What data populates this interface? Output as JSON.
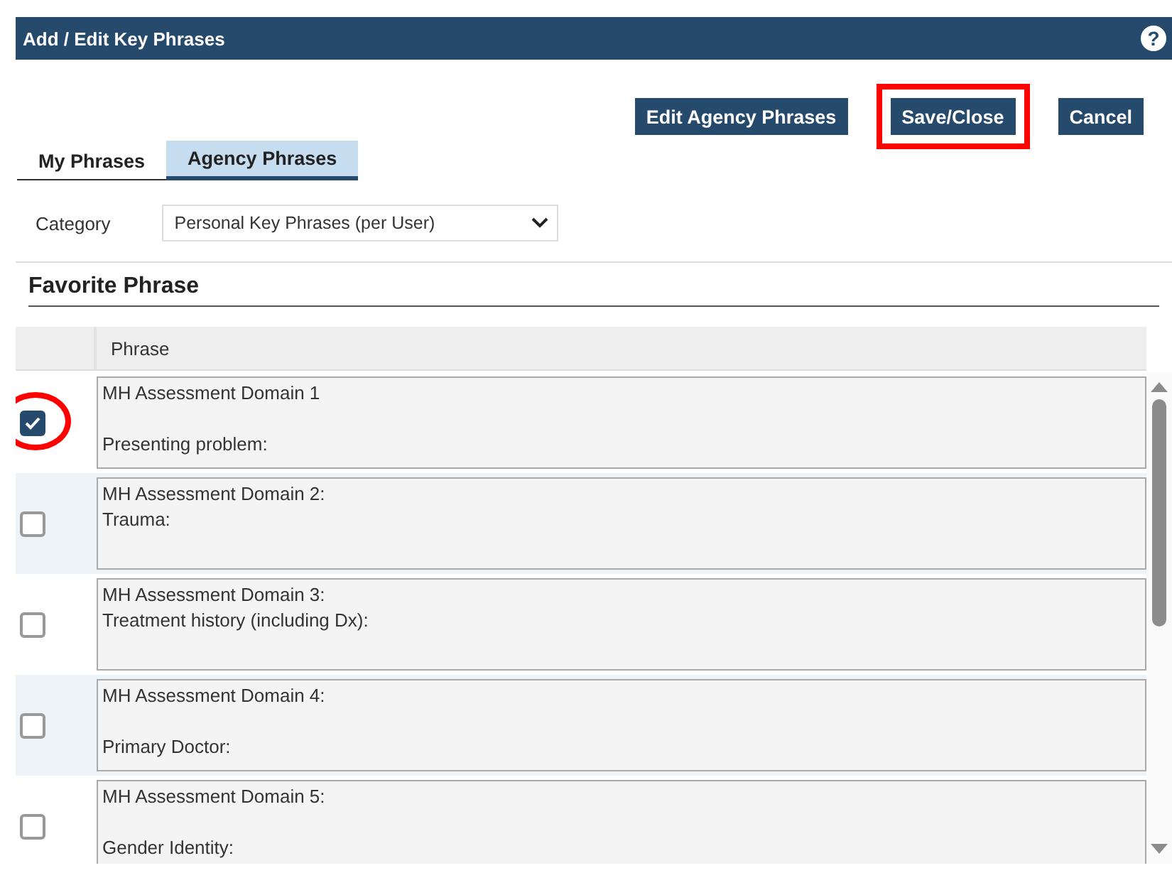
{
  "window": {
    "title": "Add / Edit Key Phrases",
    "help": "?"
  },
  "buttons": [
    {
      "label": "Edit Agency Phrases",
      "highlighted": false
    },
    {
      "label": "Save/Close",
      "highlighted": true
    },
    {
      "label": "Cancel",
      "highlighted": false
    }
  ],
  "tabs": [
    {
      "label": "My Phrases",
      "selected": false
    },
    {
      "label": "Agency Phrases",
      "selected": true
    }
  ],
  "category": {
    "label": "Category",
    "value": "Personal Key Phrases (per User)"
  },
  "section": {
    "title": "Favorite Phrase"
  },
  "table": {
    "columns": [
      "Phrase"
    ],
    "rows": [
      {
        "checked": true,
        "highlighted": true,
        "text": "MH Assessment Domain 1\n\nPresenting problem:"
      },
      {
        "checked": false,
        "highlighted": false,
        "text": "MH Assessment Domain 2:\nTrauma:"
      },
      {
        "checked": false,
        "highlighted": false,
        "text": "MH Assessment Domain 3:\nTreatment history (including Dx):"
      },
      {
        "checked": false,
        "highlighted": false,
        "text": "MH Assessment Domain 4:\n\nPrimary Doctor:"
      },
      {
        "checked": false,
        "highlighted": false,
        "text": "MH Assessment Domain 5:\n\nGender Identity:"
      }
    ]
  }
}
